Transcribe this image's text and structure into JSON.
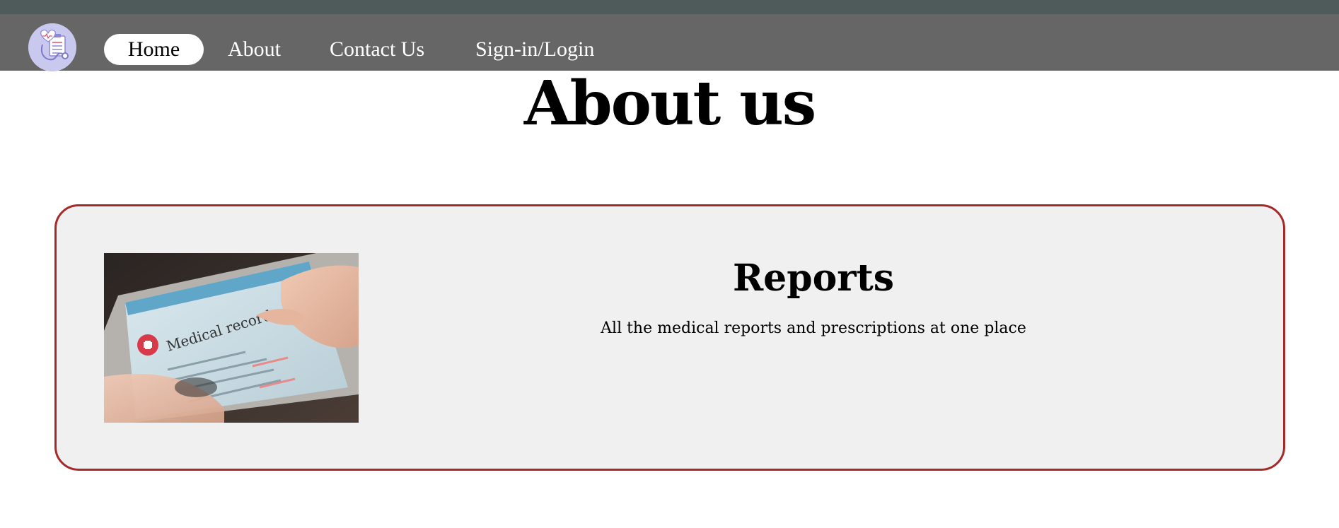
{
  "nav": {
    "logo_icon": "medical-clipboard-stethoscope-icon",
    "items": [
      {
        "label": "Home",
        "active": true
      },
      {
        "label": "About",
        "active": false
      },
      {
        "label": "Contact Us",
        "active": false
      },
      {
        "label": "Sign-in/Login",
        "active": false
      }
    ]
  },
  "main": {
    "title": "About us",
    "card": {
      "heading": "Reports",
      "description": "All the medical reports and prescriptions at one place",
      "image_text": "Medical record",
      "image_icon": "tablet-medical-record-photo"
    }
  },
  "colors": {
    "top_strip": "#4f5a5a",
    "navbar": "#666666",
    "card_border": "#a52a2a",
    "card_background": "#f0f0f0"
  }
}
